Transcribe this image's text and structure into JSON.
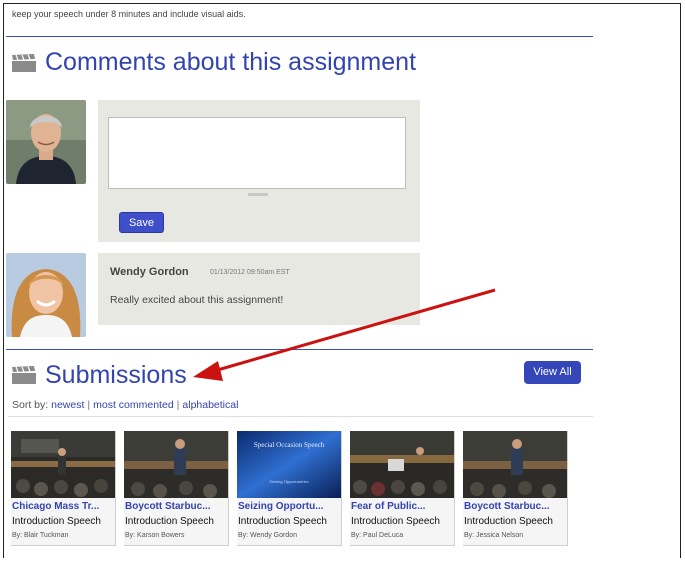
{
  "intro_text": "keep your speech under 8 minutes and include visual aids.",
  "comments_section": {
    "title": "Comments about this assignment",
    "new_comment": {
      "value": "",
      "save_label": "Save"
    },
    "comments": [
      {
        "author": "Wendy Gordon",
        "timestamp": "01/13/2012 09:50am EST",
        "text": "Really excited about this assignment!"
      }
    ]
  },
  "submissions_section": {
    "title": "Submissions",
    "view_all_label": "View All",
    "sort_label": "Sort by:",
    "sort_options": [
      "newest",
      "most commented",
      "alphabetical"
    ],
    "items": [
      {
        "title": "Chicago Mass Tr...",
        "subtitle": "Introduction Speech",
        "by": "By: Blair Tuckman"
      },
      {
        "title": "Boycott Starbuc...",
        "subtitle": "Introduction Speech",
        "by": "By: Karson Bowers"
      },
      {
        "title": "Seizing Opportu...",
        "subtitle": "Introduction Speech",
        "by": "By: Wendy Gordon",
        "slide_title": "Special Occasion Speech",
        "slide_sub": "Seizing Opportunities"
      },
      {
        "title": "Fear of Public...",
        "subtitle": "Introduction Speech",
        "by": "By: Paul DeLuca"
      },
      {
        "title": "Boycott Starbuc...",
        "subtitle": "Introduction Speech",
        "by": "By: Jessica Nelson"
      }
    ]
  },
  "colors": {
    "accent": "#3344b0",
    "button": "#3f4fc9",
    "annotation_arrow": "#cc1111"
  },
  "icons": {
    "section": "clapperboard-icon",
    "annotation": "red-arrow"
  }
}
